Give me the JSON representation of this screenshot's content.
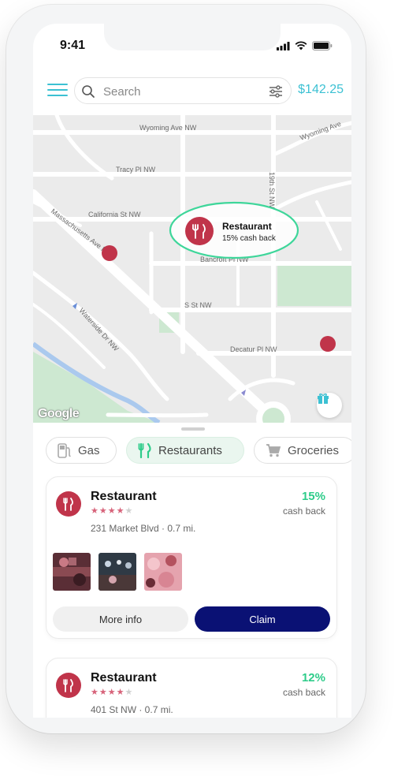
{
  "status_bar": {
    "time": "9:41"
  },
  "header": {
    "search_placeholder": "Search",
    "balance": "$142.25",
    "accent_color": "#3cc1d3"
  },
  "map": {
    "streets": [
      "Wyoming Ave NW",
      "Wyoming Ave",
      "Tracy Pl NW",
      "California St NW",
      "19th St NW",
      "Massachusetts Ave NW",
      "Bancroft Pl NW",
      "S St NW",
      "Waterside Dr NW",
      "Decatur Pl NW"
    ],
    "selected_pin": {
      "title": "Restaurant",
      "subtitle": "15% cash back"
    },
    "attribution": "Google",
    "pin_color": "#c0344a",
    "highlight_color": "#3ed69a"
  },
  "categories": [
    {
      "label": "Gas",
      "icon": "gas-pump-icon",
      "active": false
    },
    {
      "label": "Restaurants",
      "icon": "fork-knife-icon",
      "active": true
    },
    {
      "label": "Groceries",
      "icon": "cart-icon",
      "active": false
    }
  ],
  "offers": [
    {
      "name": "Restaurant",
      "rating": 4,
      "rating_max": 5,
      "address": "231 Market Blvd · 0.7 mi.",
      "cashback_percent": "15%",
      "cashback_label": "cash back",
      "more_info_label": "More info",
      "claim_label": "Claim"
    },
    {
      "name": "Restaurant",
      "rating": 4,
      "rating_max": 5,
      "address": "401 St NW · 0.7 mi.",
      "cashback_percent": "12%",
      "cashback_label": "cash back"
    }
  ],
  "colors": {
    "primary_button": "#0a1174",
    "cashback_green": "#2ecc8a",
    "restaurant_red": "#c0344a",
    "star_color": "#d7637a"
  }
}
